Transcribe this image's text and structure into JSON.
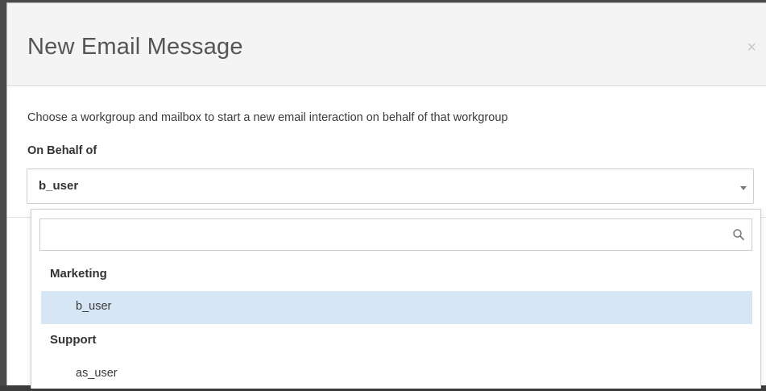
{
  "dialog": {
    "title": "New Email Message",
    "close_symbol": "×",
    "description": "Choose a workgroup and mailbox to start a new email interaction on behalf of that workgroup",
    "field_label": "On Behalf of",
    "selected_value": "b_user"
  },
  "dropdown": {
    "search_placeholder": "",
    "search_value": "",
    "groups": [
      {
        "label": "Marketing",
        "options": [
          {
            "label": "b_user",
            "selected": true
          }
        ]
      },
      {
        "label": "Support",
        "options": [
          {
            "label": "as_user",
            "selected": false
          }
        ]
      }
    ]
  },
  "icons": {
    "close": "close-icon",
    "dropdown_arrow": "chevron-down-icon",
    "search": "search-icon"
  },
  "colors": {
    "selected_option_bg": "#d6e6f4",
    "header_bg": "#f4f4f4",
    "backdrop": "#4a4a4a"
  }
}
